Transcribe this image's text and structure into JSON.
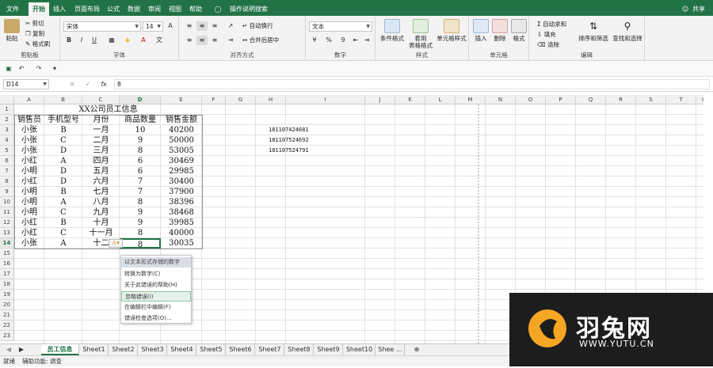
{
  "ribbon_tabs": [
    "文件",
    "开始",
    "插入",
    "页面布局",
    "公式",
    "数据",
    "审阅",
    "视图",
    "帮助"
  ],
  "tell_me": "操作说明搜索",
  "share": "共享",
  "clipboard": {
    "paste": "粘贴",
    "cut": "剪切",
    "copy": "复制",
    "format_painter": "格式刷",
    "label": "剪贴板"
  },
  "font": {
    "name": "宋体",
    "size": "14",
    "bold": "B",
    "italic": "I",
    "underline": "U",
    "label": "字体"
  },
  "alignment": {
    "wrap": "自动换行",
    "merge": "合并后居中",
    "label": "对齐方式"
  },
  "number": {
    "format": "文本",
    "percent": "%",
    "comma": "9",
    "label": "数字"
  },
  "styles": {
    "conditional": "条件格式",
    "table1": "套用",
    "table2": "表格格式",
    "cell_styles": "单元格样式",
    "label": "样式"
  },
  "cells": {
    "insert": "插入",
    "delete": "删除",
    "format": "格式",
    "label": "单元格"
  },
  "editing": {
    "autosum": "自动求和",
    "fill": "填充",
    "clear": "清除",
    "sort": "排序和筛选",
    "find": "查找和选择",
    "label": "编辑"
  },
  "formula_bar": {
    "name_box": "D14",
    "fx": "fx",
    "value": "8"
  },
  "columns": [
    "A",
    "B",
    "C",
    "D",
    "E",
    "F",
    "G",
    "H",
    "I",
    "J",
    "K",
    "L",
    "M",
    "N",
    "O",
    "P",
    "Q",
    "R",
    "S",
    "T",
    "U"
  ],
  "rows": [
    "1",
    "2",
    "3",
    "4",
    "5",
    "6",
    "7",
    "8",
    "9",
    "10",
    "11",
    "12",
    "13",
    "14",
    "15",
    "16",
    "17",
    "18",
    "19",
    "20",
    "21",
    "22",
    "23"
  ],
  "title": "XX公司员工信息",
  "headers": [
    "销售员",
    "手机型号",
    "月份",
    "商品数量",
    "销售金额"
  ],
  "table": [
    [
      "小张",
      "B",
      "一月",
      "10",
      "40200"
    ],
    [
      "小张",
      "C",
      "二月",
      "9",
      "50000"
    ],
    [
      "小张",
      "D",
      "三月",
      "8",
      "53005"
    ],
    [
      "小红",
      "A",
      "四月",
      "6",
      "30469"
    ],
    [
      "小明",
      "D",
      "五月",
      "6",
      "29985"
    ],
    [
      "小红",
      "D",
      "六月",
      "7",
      "30400"
    ],
    [
      "小明",
      "B",
      "七月",
      "7",
      "37900"
    ],
    [
      "小明",
      "A",
      "八月",
      "8",
      "38396"
    ],
    [
      "小明",
      "C",
      "九月",
      "9",
      "38468"
    ],
    [
      "小红",
      "B",
      "十月",
      "9",
      "39985"
    ],
    [
      "小红",
      "C",
      "十一月",
      "8",
      "40000"
    ],
    [
      "小张",
      "A",
      "十二",
      "8",
      "30035"
    ]
  ],
  "h_column": [
    "181107424681",
    "181107524692",
    "181107524791"
  ],
  "error_menu": {
    "title": "以文本形式存储的数字",
    "items": [
      "转换为数字(C)",
      "关于此错误的帮助(H)",
      "忽略错误(I)",
      "在编辑栏中编辑(F)",
      "错误检查选项(O)..."
    ]
  },
  "sheet_tabs": [
    "员工信息",
    "Sheet1",
    "Sheet2",
    "Sheet3",
    "Sheet4",
    "Sheet5",
    "Sheet6",
    "Sheet7",
    "Sheet8",
    "Sheet9",
    "Sheet10",
    "Shee ..."
  ],
  "status": {
    "ready": "就绪",
    "accessibility": "辅助功能: 调查"
  },
  "watermark": {
    "brand": "羽兔网",
    "url": "WWW.YUTU.CN"
  },
  "colors": {
    "excel_green": "#217346",
    "selection": "#217346"
  }
}
